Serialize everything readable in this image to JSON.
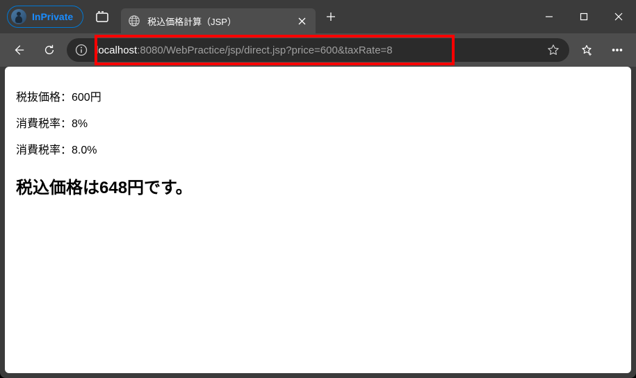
{
  "window": {
    "inprivate_label": "InPrivate"
  },
  "tab": {
    "title": "税込価格計算（JSP）"
  },
  "address": {
    "host": "localhost",
    "rest": ":8080/WebPractice/jsp/direct.jsp?price=600&taxRate=8"
  },
  "page": {
    "line1": "税抜価格：600円",
    "line2": "消費税率：8%",
    "line3": "消費税率：8.0%",
    "heading": "税込価格は648円です。"
  }
}
